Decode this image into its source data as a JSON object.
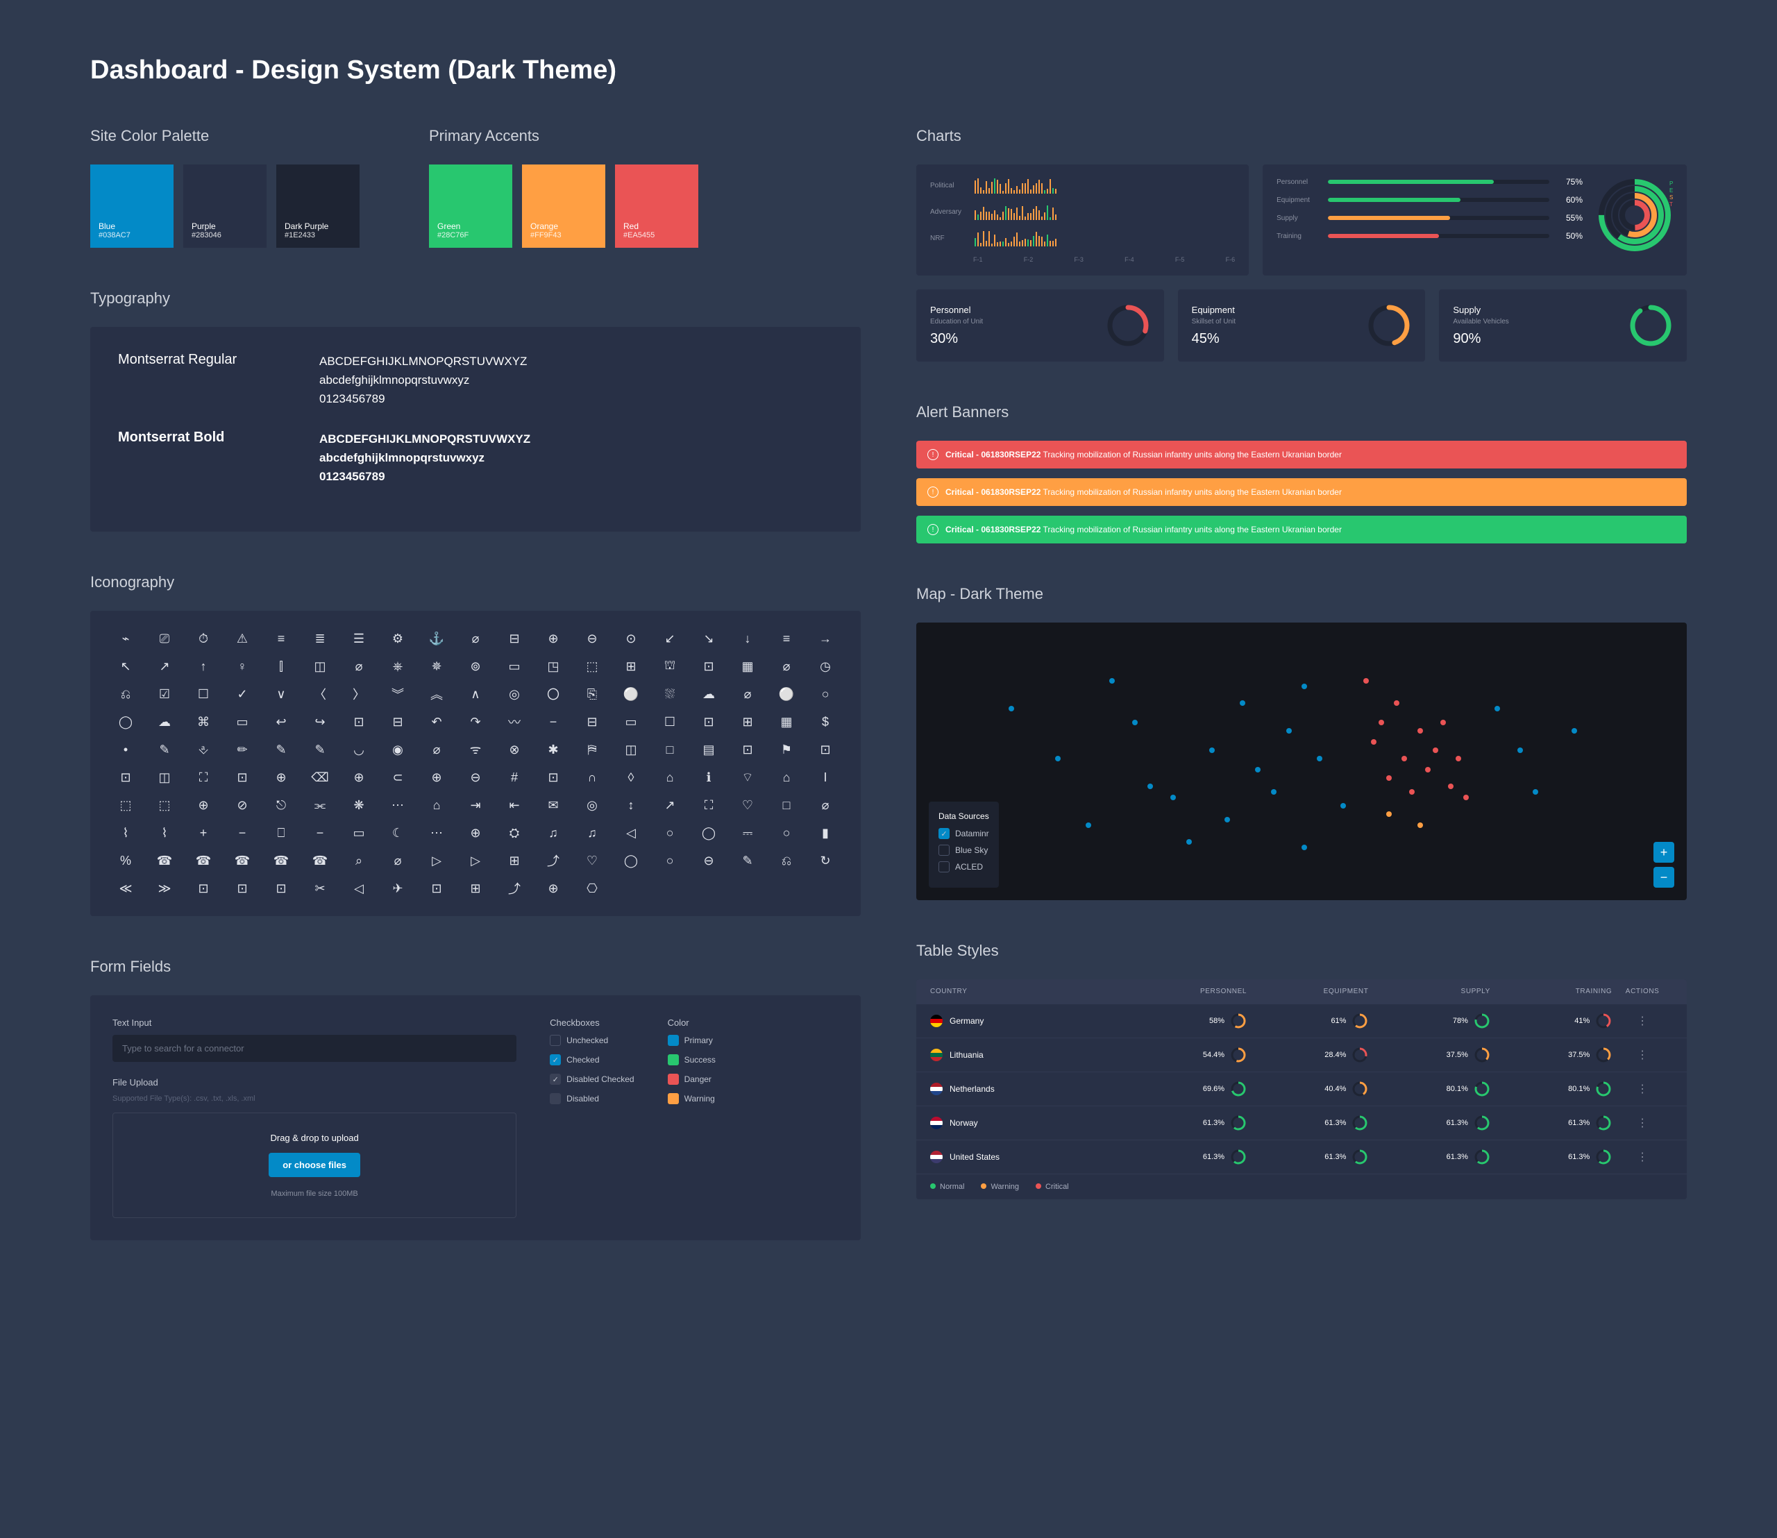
{
  "title": "Dashboard - Design System (Dark Theme)",
  "sections": {
    "palette": "Site Color Palette",
    "accents": "Primary Accents",
    "typo": "Typography",
    "icons": "Iconography",
    "forms": "Form Fields",
    "charts": "Charts",
    "alerts": "Alert Banners",
    "map": "Map - Dark Theme",
    "table": "Table Styles"
  },
  "palette": [
    {
      "name": "Blue",
      "hex": "#038AC7",
      "bg": "#038AC7"
    },
    {
      "name": "Purple",
      "hex": "#283046",
      "bg": "#283046"
    },
    {
      "name": "Dark Purple",
      "hex": "#1E2433",
      "bg": "#1E2433"
    }
  ],
  "accents": [
    {
      "name": "Green",
      "hex": "#28C76F",
      "bg": "#28C76F"
    },
    {
      "name": "Orange",
      "hex": "#FF9F43",
      "bg": "#FF9F43"
    },
    {
      "name": "Red",
      "hex": "#EA5455",
      "bg": "#EA5455"
    }
  ],
  "typo": {
    "regular_name": "Montserrat Regular",
    "bold_name": "Montserrat Bold",
    "upper": "ABCDEFGHIJKLMNOPQRSTUVWXYZ",
    "lower": "abcdefghijklmnopqrstuvwxyz",
    "nums": "0123456789"
  },
  "forms": {
    "text_label": "Text Input",
    "text_placeholder": "Type to search for a connector",
    "upload_label": "File Upload",
    "upload_hint": "Supported File Type(s): .csv, .txt, .xls, .xml",
    "upload_drag": "Drag & drop to upload",
    "upload_btn": "or choose files",
    "upload_max": "Maximum file size 100MB",
    "cb_title": "Checkboxes",
    "cb": [
      {
        "l": "Unchecked",
        "c": false
      },
      {
        "l": "Checked",
        "c": true
      },
      {
        "l": "Disabled Checked",
        "c": true,
        "d": true
      },
      {
        "l": "Disabled",
        "c": false,
        "d": true
      }
    ],
    "color_title": "Color",
    "colors": [
      {
        "l": "Primary",
        "c": "#038AC7"
      },
      {
        "l": "Success",
        "c": "#28C76F"
      },
      {
        "l": "Danger",
        "c": "#EA5455"
      },
      {
        "l": "Warning",
        "c": "#FF9F43"
      }
    ]
  },
  "chart_data": {
    "sparklines": {
      "rows": [
        "Political",
        "Adversary",
        "NRF"
      ],
      "x": [
        "F-1",
        "F-2",
        "F-3",
        "F-4",
        "F-5",
        "F-6"
      ]
    },
    "bars": [
      {
        "label": "Personnel",
        "pct": 75,
        "color": "#28C76F"
      },
      {
        "label": "Equipment",
        "pct": 60,
        "color": "#28C76F"
      },
      {
        "label": "Supply",
        "pct": 55,
        "color": "#FF9F43"
      },
      {
        "label": "Training",
        "pct": 50,
        "color": "#EA5455"
      }
    ],
    "radial_labels": [
      "P",
      "E",
      "S",
      "T"
    ],
    "kpis": [
      {
        "title": "Personnel",
        "sub": "Education of Unit",
        "val": "30%",
        "color": "#EA5455",
        "pct": 30
      },
      {
        "title": "Equipment",
        "sub": "Skillset of Unit",
        "val": "45%",
        "color": "#FF9F43",
        "pct": 45
      },
      {
        "title": "Supply",
        "sub": "Available Vehicles",
        "val": "90%",
        "color": "#28C76F",
        "pct": 90
      }
    ]
  },
  "alert": {
    "severity": "Critical",
    "code": "061830RSEP22",
    "msg": "Tracking mobilization of Russian infantry units along the Eastern Ukranian border"
  },
  "map": {
    "legend_title": "Data Sources",
    "sources": [
      {
        "l": "Dataminr",
        "c": true
      },
      {
        "l": "Blue Sky",
        "c": false
      },
      {
        "l": "ACLED",
        "c": false
      }
    ]
  },
  "table": {
    "headers": [
      "COUNTRY",
      "PERSONNEL",
      "EQUIPMENT",
      "SUPPLY",
      "TRAINING",
      "ACTIONS"
    ],
    "rows": [
      {
        "country": "Germany",
        "flag": [
          "#000",
          "#DD0000",
          "#FFCE00"
        ],
        "vals": [
          {
            "p": "58%",
            "s": "w"
          },
          {
            "p": "61%",
            "s": "w"
          },
          {
            "p": "78%",
            "s": "n"
          },
          {
            "p": "41%",
            "s": "c"
          }
        ]
      },
      {
        "country": "Lithuania",
        "flag": [
          "#FDB913",
          "#006A44",
          "#C1272D"
        ],
        "vals": [
          {
            "p": "54.4%",
            "s": "w"
          },
          {
            "p": "28.4%",
            "s": "c"
          },
          {
            "p": "37.5%",
            "s": "w"
          },
          {
            "p": "37.5%",
            "s": "w"
          }
        ]
      },
      {
        "country": "Netherlands",
        "flag": [
          "#AE1C28",
          "#fff",
          "#21468B"
        ],
        "vals": [
          {
            "p": "69.6%",
            "s": "n"
          },
          {
            "p": "40.4%",
            "s": "w"
          },
          {
            "p": "80.1%",
            "s": "n"
          },
          {
            "p": "80.1%",
            "s": "n"
          }
        ]
      },
      {
        "country": "Norway",
        "flag": [
          "#BA0C2F",
          "#fff",
          "#00205B"
        ],
        "vals": [
          {
            "p": "61.3%",
            "s": "n"
          },
          {
            "p": "61.3%",
            "s": "n"
          },
          {
            "p": "61.3%",
            "s": "n"
          },
          {
            "p": "61.3%",
            "s": "n"
          }
        ]
      },
      {
        "country": "United States",
        "flag": [
          "#B22234",
          "#fff",
          "#3C3B6E"
        ],
        "vals": [
          {
            "p": "61.3%",
            "s": "n"
          },
          {
            "p": "61.3%",
            "s": "n"
          },
          {
            "p": "61.3%",
            "s": "n"
          },
          {
            "p": "61.3%",
            "s": "n"
          }
        ]
      }
    ],
    "legend": [
      {
        "l": "Normal",
        "c": "#28C76F"
      },
      {
        "l": "Warning",
        "c": "#FF9F43"
      },
      {
        "l": "Critical",
        "c": "#EA5455"
      }
    ]
  },
  "icons": [
    "⌁",
    "⎚",
    "⏱",
    "⚠",
    "≡",
    "≣",
    "☰",
    "⚙",
    "⚓",
    "⌀",
    "⊟",
    "⊕",
    "⊖",
    "⊙",
    "↙",
    "↘",
    "↓",
    "≡",
    "→",
    "↖",
    "↗",
    "↑",
    "♀",
    "⫿",
    "◫",
    "⌀",
    "⎈",
    "✵",
    "⊚",
    "▭",
    "◳",
    "⬚",
    "⊞",
    "⛫",
    "⊡",
    "▦",
    "⌀",
    "◷",
    "⎌",
    "☑",
    "☐",
    "✓",
    "∨",
    "〈",
    "〉",
    "︾",
    "︽",
    "∧",
    "◎",
    "〇",
    "⎘",
    "⚪",
    "⛆",
    "☁",
    "⌀",
    "⚪",
    "○",
    "◯",
    "☁",
    "⌘",
    "▭",
    "↩",
    "↪",
    "⊡",
    "⊟",
    "↶",
    "↷",
    "〰",
    "−",
    "⊟",
    "▭",
    "☐",
    "⊡",
    "⊞",
    "▦",
    "$",
    "•",
    "✎",
    "⎀",
    "✏",
    "✎",
    "✎",
    "◡",
    "◉",
    "⌀",
    "ᯤ",
    "⊗",
    "✱",
    "⛿",
    "◫",
    "□",
    "▤",
    "⊡",
    "⚑",
    "⊡",
    "⊡",
    "◫",
    "⛶",
    "⊡",
    "⊕",
    "⌫",
    "⊕",
    "⊂",
    "⊕",
    "⊖",
    "#",
    "⊡",
    "∩",
    "◊",
    "⌂",
    "ℹ",
    "⌔",
    "⌂",
    "I",
    "⬚",
    "⬚",
    "⊕",
    "⊘",
    "⎋",
    "⫘",
    "❋",
    "⋯",
    "⌂",
    "⇥",
    "⇤",
    "✉",
    "◎",
    "↕",
    "↗",
    "⛶",
    "♡",
    "□",
    "⌀",
    "⌇",
    "⌇",
    "+",
    "−",
    "⎕",
    "−",
    "▭",
    "☾",
    "⋯",
    "⊕",
    "⛭",
    "♫",
    "♫",
    "◁",
    "○",
    "◯",
    "⎓",
    "○",
    "▮",
    "%",
    "☎",
    "☎",
    "☎",
    "☎",
    "☎",
    "⌕",
    "⌀",
    "▷",
    "▷",
    "⊞",
    "⤴",
    "♡",
    "◯",
    "○",
    "⊖",
    "✎",
    "⎌",
    "↻",
    "≪",
    "≫",
    "⊡",
    "⊡",
    "⊡",
    "✂",
    "◁",
    "✈",
    "⊡",
    "⊞",
    "⤴",
    "⊕",
    "⎔"
  ]
}
